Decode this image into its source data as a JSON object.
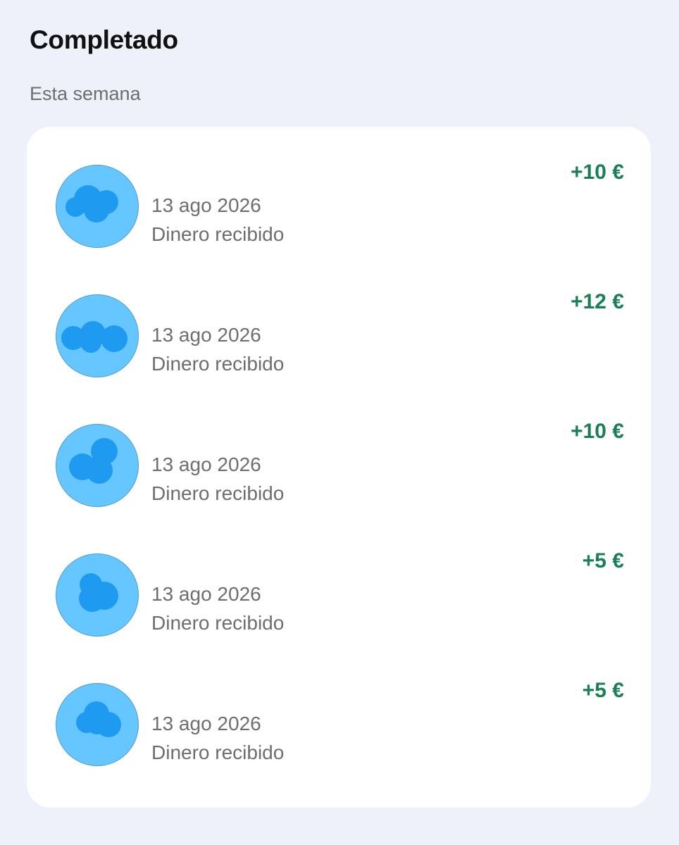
{
  "header": {
    "title": "Completado"
  },
  "section": {
    "label": "Esta semana"
  },
  "transactions": [
    {
      "date": "13 ago 2026",
      "description": "Dinero recibido",
      "amount": "+10 €",
      "avatar_icon": "blurred-avatar-icon"
    },
    {
      "date": "13 ago 2026",
      "description": "Dinero recibido",
      "amount": "+12 €",
      "avatar_icon": "blurred-avatar-icon"
    },
    {
      "date": "13 ago 2026",
      "description": "Dinero recibido",
      "amount": "+10 €",
      "avatar_icon": "blurred-avatar-icon"
    },
    {
      "date": "13 ago 2026",
      "description": "Dinero recibido",
      "amount": "+5 €",
      "avatar_icon": "blurred-avatar-icon"
    },
    {
      "date": "13 ago 2026",
      "description": "Dinero recibido",
      "amount": "+5 €",
      "avatar_icon": "blurred-avatar-icon"
    }
  ],
  "colors": {
    "background": "#eef1fa",
    "card": "#ffffff",
    "amount_positive": "#1b7f55",
    "secondary_text": "#6d6d72",
    "avatar_bg": "#66c6ff",
    "avatar_blob": "#1e9bf0"
  }
}
